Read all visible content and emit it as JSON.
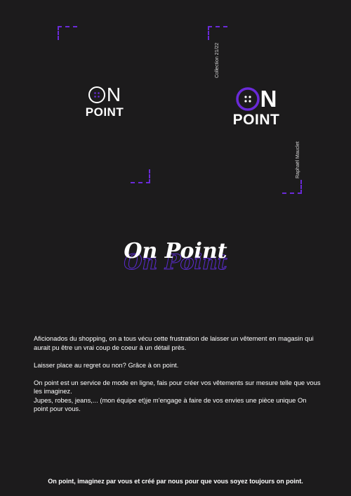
{
  "logo_small": {
    "on": "ON",
    "point": "POINT",
    "icon": "button-icon"
  },
  "logo_large": {
    "on": "ON",
    "point": "POINT",
    "icon": "button-icon"
  },
  "vertical_collection": "Collection 21/22",
  "vertical_author": "Raphaël Mauclet",
  "title": "On Point",
  "paragraphs": {
    "p1": "Aficionados du shopping, on a tous vécu cette frustration de laisser un vêtement en magasin qui aurait pu être un vrai coup de coeur à un détail près.",
    "p2": "Laisser place au regret ou non? Grâce à on point.",
    "p3a": "On point est un service de mode en ligne, fais pour créer vos vêtements sur mesure telle que vous les imaginez.",
    "p3b": "Jupes, robes, jeans,... (mon équipe et)je m'engage à faire de vos envies une pièce unique On point pour vous."
  },
  "footer": "On point, imaginez par vous et créé par nous pour que vous soyez toujours on point.",
  "colors": {
    "background": "#1c1b1c",
    "accent": "#6a2ad8",
    "text": "#ffffff"
  }
}
